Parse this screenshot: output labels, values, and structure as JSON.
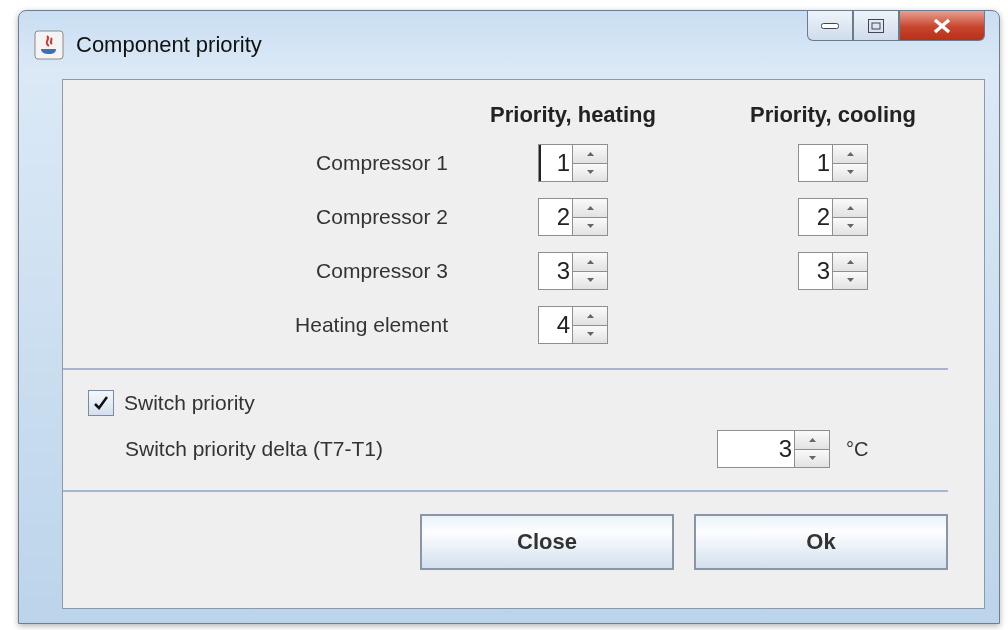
{
  "window": {
    "title": "Component priority"
  },
  "columns": [
    "Priority, heating",
    "Priority, cooling"
  ],
  "rows": [
    {
      "label": "Compressor 1",
      "heating": {
        "value": "1",
        "focused": true
      },
      "cooling": {
        "value": "1",
        "focused": false
      }
    },
    {
      "label": "Compressor 2",
      "heating": {
        "value": "2",
        "focused": false
      },
      "cooling": {
        "value": "2",
        "focused": false
      }
    },
    {
      "label": "Compressor 3",
      "heating": {
        "value": "3",
        "focused": false
      },
      "cooling": {
        "value": "3",
        "focused": false
      }
    },
    {
      "label": "Heating element",
      "heating": {
        "value": "4",
        "focused": false
      }
    }
  ],
  "switch_priority": {
    "label": "Switch priority",
    "checked": true
  },
  "delta": {
    "label": "Switch priority delta (T7-T1)",
    "value": "3",
    "unit": "°C"
  },
  "buttons": [
    "Close",
    "Ok"
  ]
}
